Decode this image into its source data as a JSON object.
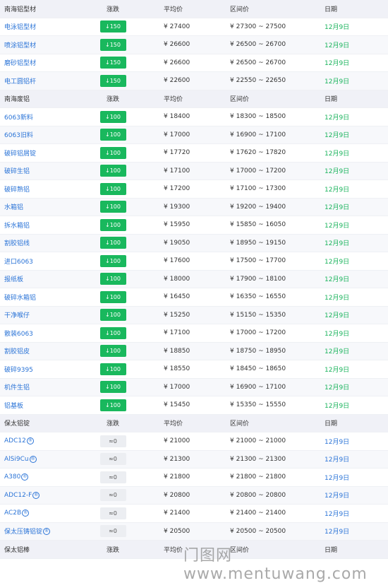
{
  "sections": [
    {
      "header": {
        "name": "南海铝型材",
        "change": "涨跌",
        "avg": "平均价",
        "range": "区间价",
        "date": "日期"
      },
      "rows": [
        {
          "name": "电泳铝型材",
          "change": "↓150",
          "avg": "¥ 27400",
          "range": "¥ 27300 ~ 27500",
          "date": "12月9日"
        },
        {
          "name": "喷涂铝型材",
          "change": "↓150",
          "avg": "¥ 26600",
          "range": "¥ 26500 ~ 26700",
          "date": "12月9日"
        },
        {
          "name": "磨砂铝型材",
          "change": "↓150",
          "avg": "¥ 26600",
          "range": "¥ 26500 ~ 26700",
          "date": "12月9日"
        },
        {
          "name": "电工圆铝杆",
          "change": "↓150",
          "avg": "¥ 22600",
          "range": "¥ 22550 ~ 22650",
          "date": "12月9日"
        }
      ]
    },
    {
      "header": {
        "name": "南海废铝",
        "change": "涨跌",
        "avg": "平均价",
        "range": "区间价",
        "date": "日期"
      },
      "rows": [
        {
          "name": "6063新料",
          "change": "↓100",
          "avg": "¥ 18400",
          "range": "¥ 18300 ~ 18500",
          "date": "12月9日"
        },
        {
          "name": "6063旧料",
          "change": "↓100",
          "avg": "¥ 17000",
          "range": "¥ 16900 ~ 17100",
          "date": "12月9日"
        },
        {
          "name": "破碎铝屑锭",
          "change": "↓100",
          "avg": "¥ 17720",
          "range": "¥ 17620 ~ 17820",
          "date": "12月9日"
        },
        {
          "name": "破碎生铝",
          "change": "↓100",
          "avg": "¥ 17100",
          "range": "¥ 17000 ~ 17200",
          "date": "12月9日"
        },
        {
          "name": "破碎熟铝",
          "change": "↓100",
          "avg": "¥ 17200",
          "range": "¥ 17100 ~ 17300",
          "date": "12月9日"
        },
        {
          "name": "水箱铝",
          "change": "↓100",
          "avg": "¥ 19300",
          "range": "¥ 19200 ~ 19400",
          "date": "12月9日"
        },
        {
          "name": "拆水箱铝",
          "change": "↓100",
          "avg": "¥ 15950",
          "range": "¥ 15850 ~ 16050",
          "date": "12月9日"
        },
        {
          "name": "割胶铝线",
          "change": "↓100",
          "avg": "¥ 19050",
          "range": "¥ 18950 ~ 19150",
          "date": "12月9日"
        },
        {
          "name": "进口6063",
          "change": "↓100",
          "avg": "¥ 17600",
          "range": "¥ 17500 ~ 17700",
          "date": "12月9日"
        },
        {
          "name": "报纸板",
          "change": "↓100",
          "avg": "¥ 18000",
          "range": "¥ 17900 ~ 18100",
          "date": "12月9日"
        },
        {
          "name": "破碎水箱铝",
          "change": "↓100",
          "avg": "¥ 16450",
          "range": "¥ 16350 ~ 16550",
          "date": "12月9日"
        },
        {
          "name": "干净喉仔",
          "change": "↓100",
          "avg": "¥ 15250",
          "range": "¥ 15150 ~ 15350",
          "date": "12月9日"
        },
        {
          "name": "散装6063",
          "change": "↓100",
          "avg": "¥ 17100",
          "range": "¥ 17000 ~ 17200",
          "date": "12月9日"
        },
        {
          "name": "割胶铝皮",
          "change": "↓100",
          "avg": "¥ 18850",
          "range": "¥ 18750 ~ 18950",
          "date": "12月9日"
        },
        {
          "name": "破碎9395",
          "change": "↓100",
          "avg": "¥ 18550",
          "range": "¥ 18450 ~ 18650",
          "date": "12月9日"
        },
        {
          "name": "机件生铝",
          "change": "↓100",
          "avg": "¥ 17000",
          "range": "¥ 16900 ~ 17100",
          "date": "12月9日"
        },
        {
          "name": "铝基板",
          "change": "↓100",
          "avg": "¥ 15450",
          "range": "¥ 15350 ~ 15550",
          "date": "12月9日"
        }
      ]
    },
    {
      "header": {
        "name": "保太铝锭",
        "change": "涨跌",
        "avg": "平均价",
        "range": "区间价",
        "date": "日期"
      },
      "rows": [
        {
          "name": "ADC12",
          "reg": "®",
          "change": "≈0",
          "avg": "¥ 21000",
          "range": "¥ 21000 ~ 21000",
          "date": "12月9日"
        },
        {
          "name": "AlSi9Cu",
          "reg": "®",
          "change": "≈0",
          "avg": "¥ 21300",
          "range": "¥ 21300 ~ 21300",
          "date": "12月9日"
        },
        {
          "name": "A380",
          "reg": "®",
          "change": "≈0",
          "avg": "¥ 21800",
          "range": "¥ 21800 ~ 21800",
          "date": "12月9日"
        },
        {
          "name": "ADC12-F",
          "reg": "®",
          "change": "≈0",
          "avg": "¥ 20800",
          "range": "¥ 20800 ~ 20800",
          "date": "12月9日"
        },
        {
          "name": "AC2B",
          "reg": "®",
          "change": "≈0",
          "avg": "¥ 21400",
          "range": "¥ 21400 ~ 21400",
          "date": "12月9日"
        },
        {
          "name": "保太压铸铝锭",
          "reg": "®",
          "change": "≈0",
          "avg": "¥ 20500",
          "range": "¥ 20500 ~ 20500",
          "date": "12月9日"
        }
      ]
    },
    {
      "header": {
        "name": "保太铝棒",
        "change": "涨跌",
        "avg": "平均价",
        "range": "区间价",
        "date": "日期"
      },
      "rows": []
    }
  ],
  "watermark": "门图网 www.mentuwang.com",
  "colors": {
    "down": "#19b85d",
    "flat": "#eceef2",
    "header_bg": "#f0f1f7",
    "link": "#2b74d7",
    "date_green": "#18b35b"
  }
}
